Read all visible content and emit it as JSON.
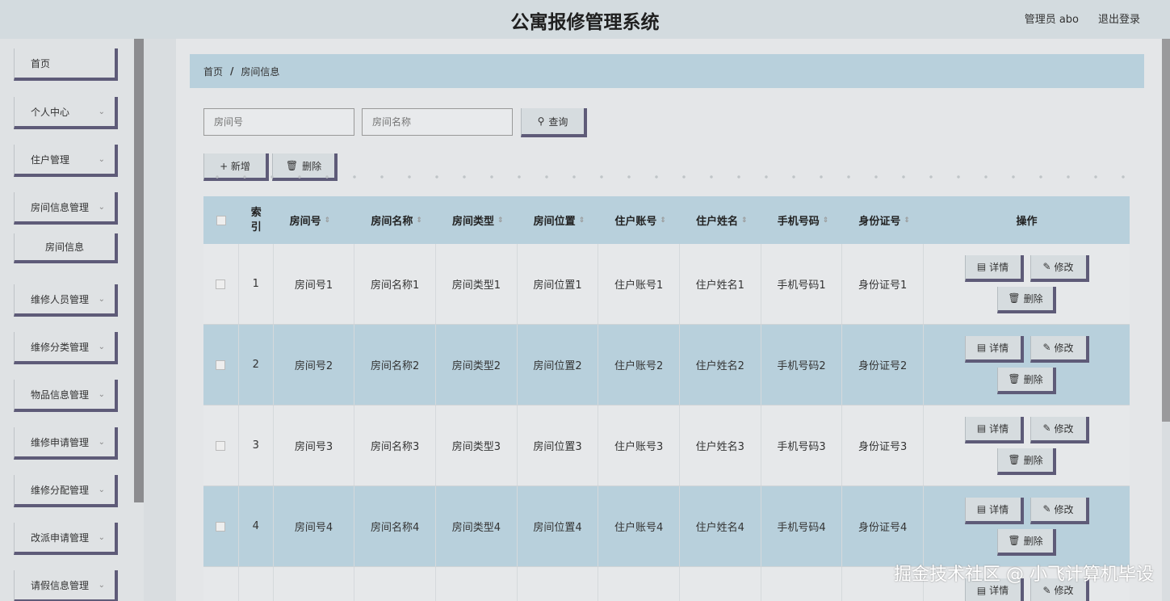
{
  "header": {
    "title": "公寓报修管理系统",
    "user": "管理员 abo",
    "logout": "退出登录"
  },
  "sidebar": {
    "items": [
      {
        "label": "首页",
        "chev": ""
      },
      {
        "label": "个人中心",
        "chev": "⌄"
      },
      {
        "label": "住户管理",
        "chev": "⌄"
      },
      {
        "label": "房间信息管理",
        "chev": "⌄"
      },
      {
        "label": "房间信息",
        "chev": ""
      },
      {
        "label": "维修人员管理",
        "chev": "⌄"
      },
      {
        "label": "维修分类管理",
        "chev": "⌄"
      },
      {
        "label": "物品信息管理",
        "chev": "⌄"
      },
      {
        "label": "维修申请管理",
        "chev": "⌄"
      },
      {
        "label": "维修分配管理",
        "chev": "⌄"
      },
      {
        "label": "改派申请管理",
        "chev": "⌄"
      },
      {
        "label": "请假信息管理",
        "chev": "⌄"
      }
    ]
  },
  "breadcrumb": {
    "home": "首页",
    "sep": "/",
    "current": "房间信息"
  },
  "search": {
    "room_no_placeholder": "房间号",
    "room_name_placeholder": "房间名称",
    "query_label": "查询",
    "query_icon": "search-icon"
  },
  "toolbar": {
    "add_label": "+ 新增",
    "delete_label": "删除"
  },
  "table": {
    "headers": [
      "索引",
      "房间号",
      "房间名称",
      "房间类型",
      "房间位置",
      "住户账号",
      "住户姓名",
      "手机号码",
      "身份证号",
      "操作"
    ],
    "rows": [
      {
        "index": "1",
        "cells": [
          "房间号1",
          "房间名称1",
          "房间类型1",
          "房间位置1",
          "住户账号1",
          "住户姓名1",
          "手机号码1",
          "身份证号1"
        ]
      },
      {
        "index": "2",
        "cells": [
          "房间号2",
          "房间名称2",
          "房间类型2",
          "房间位置2",
          "住户账号2",
          "住户姓名2",
          "手机号码2",
          "身份证号2"
        ]
      },
      {
        "index": "3",
        "cells": [
          "房间号3",
          "房间名称3",
          "房间类型3",
          "房间位置3",
          "住户账号3",
          "住户姓名3",
          "手机号码3",
          "身份证号3"
        ]
      },
      {
        "index": "4",
        "cells": [
          "房间号4",
          "房间名称4",
          "房间类型4",
          "房间位置4",
          "住户账号4",
          "住户姓名4",
          "手机号码4",
          "身份证号4"
        ]
      }
    ],
    "ops": {
      "detail": "详情",
      "edit": "修改",
      "delete": "删除"
    }
  },
  "watermark": "掘金技术社区 @ 小飞计算机毕设"
}
